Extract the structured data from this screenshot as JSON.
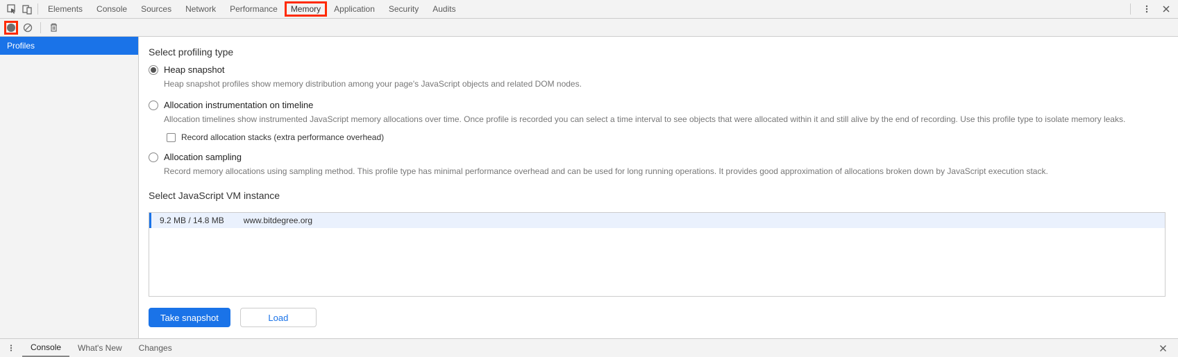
{
  "top_tabs": {
    "elements": "Elements",
    "console": "Console",
    "sources": "Sources",
    "network": "Network",
    "performance": "Performance",
    "memory": "Memory",
    "application": "Application",
    "security": "Security",
    "audits": "Audits"
  },
  "sidebar": {
    "profiles": "Profiles"
  },
  "main": {
    "profiling_heading": "Select profiling type",
    "options": {
      "heap": {
        "label": "Heap snapshot",
        "desc": "Heap snapshot profiles show memory distribution among your page's JavaScript objects and related DOM nodes."
      },
      "timeline": {
        "label": "Allocation instrumentation on timeline",
        "desc": "Allocation timelines show instrumented JavaScript memory allocations over time. Once profile is recorded you can select a time interval to see objects that were allocated within it and still alive by the end of recording. Use this profile type to isolate memory leaks.",
        "checkbox": "Record allocation stacks (extra performance overhead)"
      },
      "sampling": {
        "label": "Allocation sampling",
        "desc": "Record memory allocations using sampling method. This profile type has minimal performance overhead and can be used for long running operations. It provides good approximation of allocations broken down by JavaScript execution stack."
      }
    },
    "vm_heading": "Select JavaScript VM instance",
    "vm_row": {
      "size": "9.2 MB / 14.8 MB",
      "url": "www.bitdegree.org"
    },
    "buttons": {
      "take_snapshot": "Take snapshot",
      "load": "Load"
    }
  },
  "drawer": {
    "console": "Console",
    "whats_new": "What's New",
    "changes": "Changes"
  }
}
